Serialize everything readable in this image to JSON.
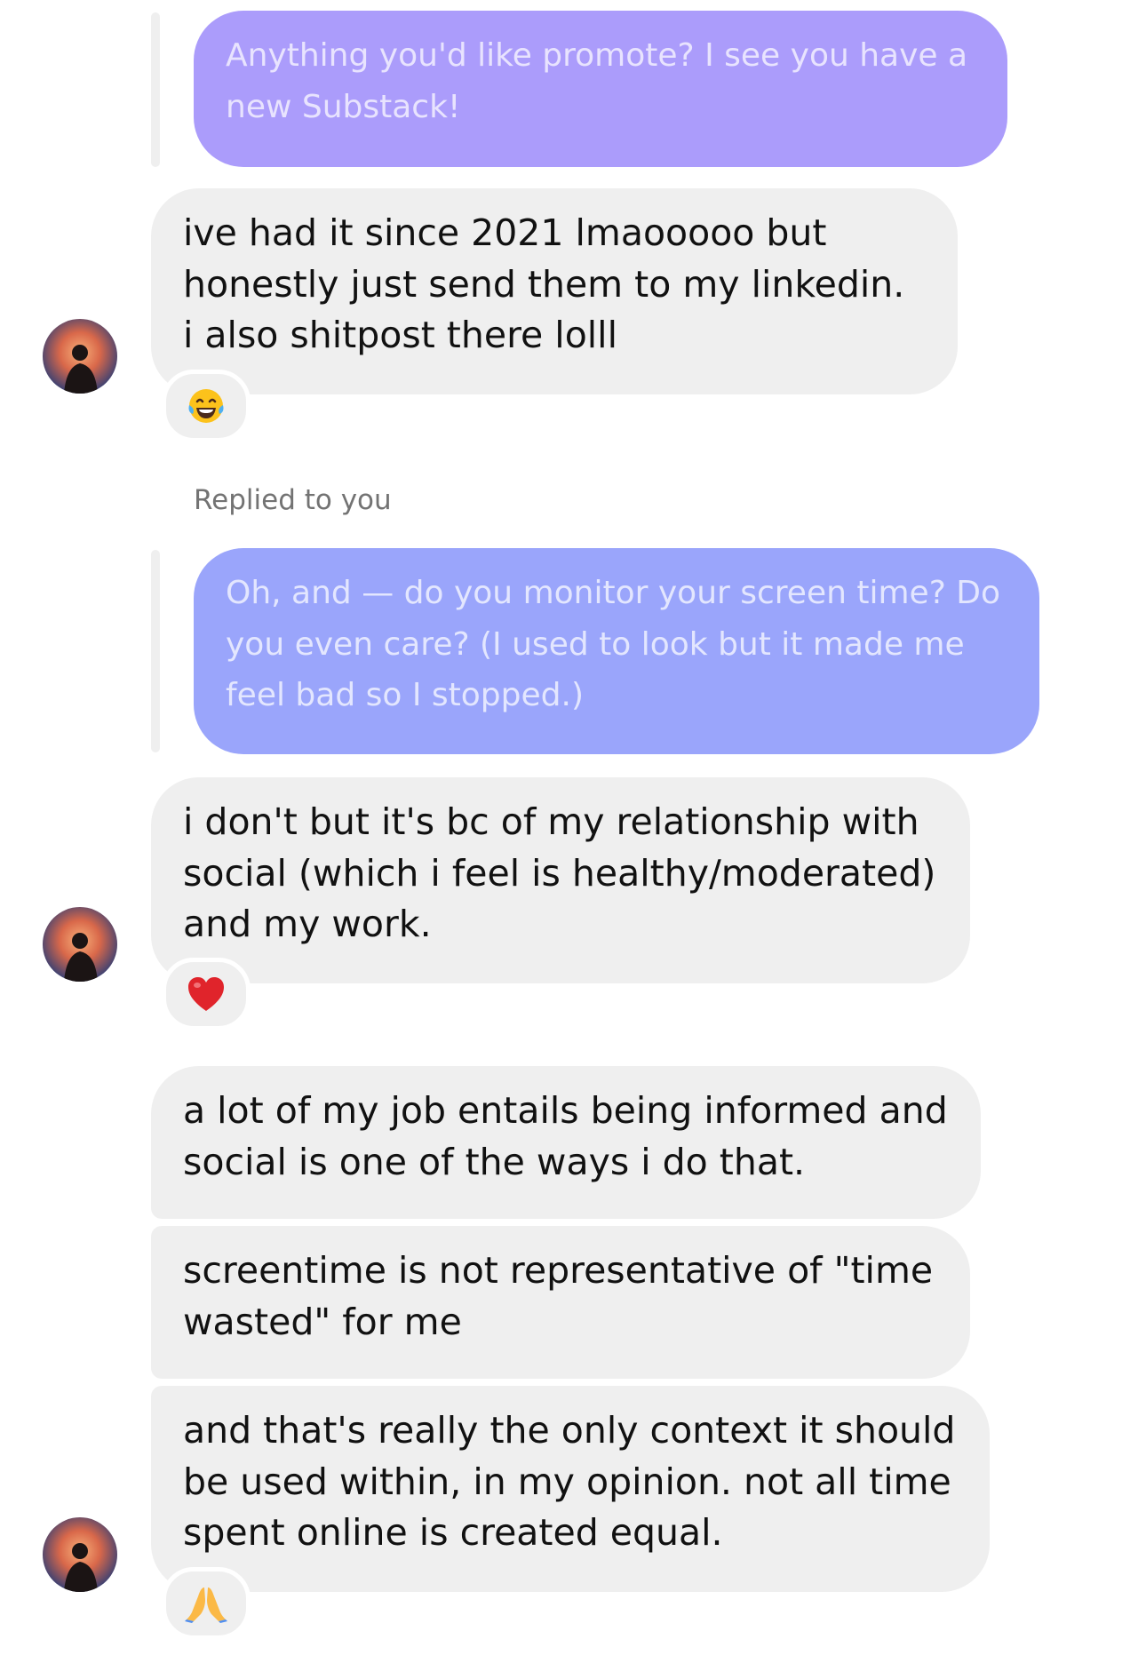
{
  "thread": {
    "messages": [
      {
        "id": "m1",
        "sender": "you",
        "quoted_text": "Anything you'd like promote? I see you have a new Substack!",
        "quoted_color": "#ab9cfb"
      },
      {
        "id": "m2",
        "sender": "them",
        "text": "ive had it since 2021 lmaooooo but honestly just send them to my linkedin. i also shitpost there  lolll",
        "reaction": "laughing-tears-emoji"
      },
      {
        "id": "m3",
        "sender": "you",
        "reply_label": "Replied to you",
        "quoted_text": "Oh, and — do you monitor your screen time? Do you even care? (I used to look but it made me feel bad so I stopped.)",
        "quoted_color": "#9aa5fb"
      },
      {
        "id": "m4",
        "sender": "them",
        "text": "i don't but it's bc of my relationship with social (which i feel is healthy/moderated) and my work.",
        "reaction": "red-heart-emoji"
      },
      {
        "id": "m5",
        "sender": "them",
        "text": "a lot of my job entails being informed and social is one of the ways i do that."
      },
      {
        "id": "m6",
        "sender": "them",
        "text": "screentime is not representative of \"time wasted\" for me"
      },
      {
        "id": "m7",
        "sender": "them",
        "text": "and that's really the only context it should be used within, in my opinion. not all time spent online is created equal.",
        "reaction": "folded-hands-emoji"
      }
    ]
  },
  "colors": {
    "incoming_bubble": "#efefef",
    "reply_line": "#efefef",
    "meta_text": "#737373"
  }
}
